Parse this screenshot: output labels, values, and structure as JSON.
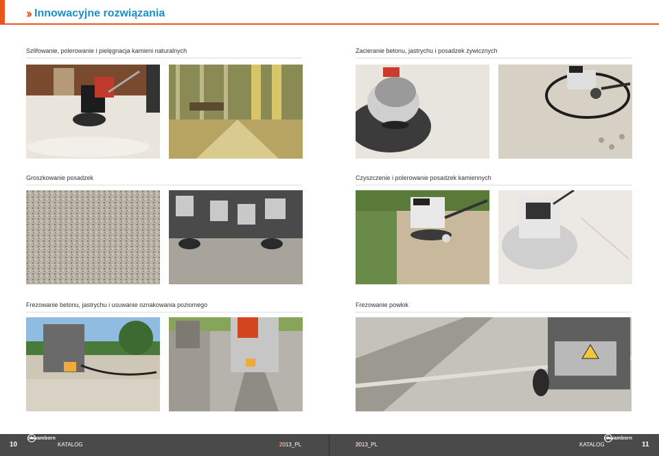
{
  "header": {
    "title": "Innowacyjne rozwiązania"
  },
  "sections": {
    "s1": {
      "label": "Szlifowanie, polerowanie i pielęgnacja kamieni naturalnych"
    },
    "s2": {
      "label": "Zacieranie betonu, jastrychu i posadzek żywicznych"
    },
    "s3": {
      "label": "Groszkowanie posadzek"
    },
    "s4": {
      "label": "Czyszczenie i polerowanie posadzek kamiennych"
    },
    "s5": {
      "label": "Frezowanie betonu, jastrychu i usuwanie oznakowania poziomego"
    },
    "s6": {
      "label": "Frezowanie powłok"
    }
  },
  "footer": {
    "left_page": "10",
    "right_page": "11",
    "katalog": "KATALOG",
    "brand": "chwamborn",
    "edition": "2013_PL",
    "edition_mark": "®"
  },
  "colors": {
    "accent": "#e8561b",
    "title_blue": "#1a8fc9",
    "footer_bg": "#4a4a4a"
  }
}
